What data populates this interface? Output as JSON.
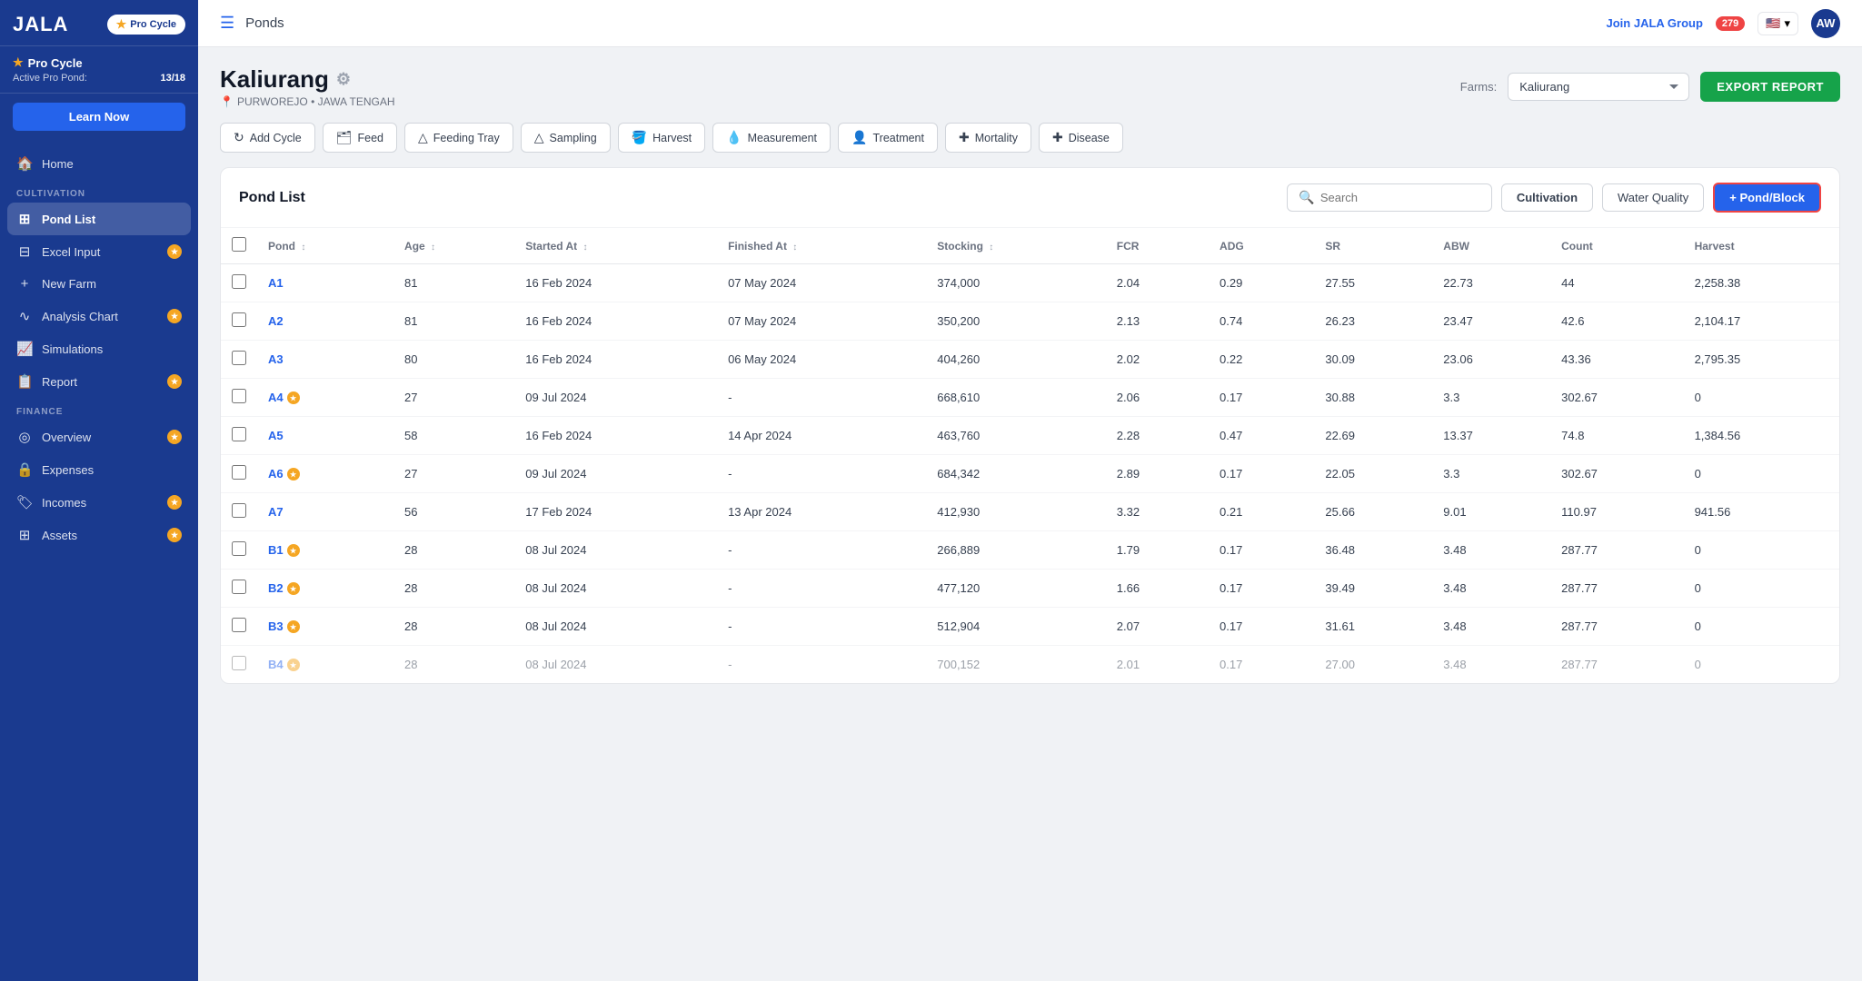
{
  "app": {
    "logo": "JALA",
    "plan_badge": "Pro Cycle",
    "plan_star": "★"
  },
  "sidebar": {
    "pro_title": "Pro Cycle",
    "active_pond_label": "Active Pro Pond:",
    "active_pond_value": "13/18",
    "learn_now": "Learn Now",
    "nav_sections": [
      {
        "label": "",
        "items": [
          {
            "id": "home",
            "icon": "🏠",
            "label": "Home",
            "active": false,
            "badge": false
          }
        ]
      },
      {
        "label": "CULTIVATION",
        "items": [
          {
            "id": "pond-list",
            "icon": "⊞",
            "label": "Pond List",
            "active": true,
            "badge": false
          },
          {
            "id": "excel-input",
            "icon": "⊟",
            "label": "Excel Input",
            "active": false,
            "badge": true
          },
          {
            "id": "new-farm",
            "icon": "+",
            "label": "New Farm",
            "active": false,
            "badge": false
          },
          {
            "id": "analysis-chart",
            "icon": "∿",
            "label": "Analysis Chart",
            "active": false,
            "badge": true
          },
          {
            "id": "simulations",
            "icon": "📈",
            "label": "Simulations",
            "active": false,
            "badge": false
          },
          {
            "id": "report",
            "icon": "📋",
            "label": "Report",
            "active": false,
            "badge": true
          }
        ]
      },
      {
        "label": "FINANCE",
        "items": [
          {
            "id": "overview",
            "icon": "◎",
            "label": "Overview",
            "active": false,
            "badge": true
          },
          {
            "id": "expenses",
            "icon": "🔒",
            "label": "Expenses",
            "active": false,
            "badge": false
          },
          {
            "id": "incomes",
            "icon": "🏷",
            "label": "Incomes",
            "active": false,
            "badge": true
          },
          {
            "id": "assets",
            "icon": "⊞",
            "label": "Assets",
            "active": false,
            "badge": true
          }
        ]
      }
    ]
  },
  "topbar": {
    "title": "Ponds",
    "join_jala": "Join JALA Group",
    "notification_count": "279",
    "flag": "🇺🇸",
    "avatar_initials": "AW"
  },
  "page": {
    "title": "Kaliurang",
    "location": "PURWOREJO • JAWA TENGAH",
    "farms_label": "Farms:",
    "farms_value": "Kaliurang",
    "export_btn": "EXPORT REPORT"
  },
  "action_buttons": [
    {
      "id": "add-cycle",
      "icon": "↻",
      "label": "Add Cycle"
    },
    {
      "id": "feed",
      "icon": "🗂",
      "label": "Feed"
    },
    {
      "id": "feeding-tray",
      "icon": "△",
      "label": "Feeding Tray"
    },
    {
      "id": "sampling",
      "icon": "△",
      "label": "Sampling"
    },
    {
      "id": "harvest",
      "icon": "🪣",
      "label": "Harvest"
    },
    {
      "id": "measurement",
      "icon": "💧",
      "label": "Measurement"
    },
    {
      "id": "treatment",
      "icon": "👤",
      "label": "Treatment"
    },
    {
      "id": "mortality",
      "icon": "✚",
      "label": "Mortality"
    },
    {
      "id": "disease",
      "icon": "✚",
      "label": "Disease"
    }
  ],
  "pond_list": {
    "title": "Pond List",
    "search_placeholder": "Search",
    "tab_cultivation": "Cultivation",
    "tab_water_quality": "Water Quality",
    "tab_pond_block": "+ Pond/Block",
    "columns": [
      {
        "id": "pond",
        "label": "Pond"
      },
      {
        "id": "age",
        "label": "Age",
        "sortable": true
      },
      {
        "id": "started_at",
        "label": "Started At",
        "sortable": true
      },
      {
        "id": "finished_at",
        "label": "Finished At",
        "sortable": true
      },
      {
        "id": "stocking",
        "label": "Stocking",
        "sortable": true
      },
      {
        "id": "fcr",
        "label": "FCR"
      },
      {
        "id": "adg",
        "label": "ADG"
      },
      {
        "id": "sr",
        "label": "SR"
      },
      {
        "id": "abw",
        "label": "ABW"
      },
      {
        "id": "count",
        "label": "Count"
      },
      {
        "id": "harvest",
        "label": "Harvest"
      }
    ],
    "rows": [
      {
        "pond": "A1",
        "pro": false,
        "age": "81",
        "started_at": "16 Feb 2024",
        "finished_at": "07 May 2024",
        "stocking": "374,000",
        "fcr": "2.04",
        "adg": "0.29",
        "sr": "27.55",
        "abw": "22.73",
        "count": "44",
        "harvest": "2,258.38"
      },
      {
        "pond": "A2",
        "pro": false,
        "age": "81",
        "started_at": "16 Feb 2024",
        "finished_at": "07 May 2024",
        "stocking": "350,200",
        "fcr": "2.13",
        "adg": "0.74",
        "sr": "26.23",
        "abw": "23.47",
        "count": "42.6",
        "harvest": "2,104.17"
      },
      {
        "pond": "A3",
        "pro": false,
        "age": "80",
        "started_at": "16 Feb 2024",
        "finished_at": "06 May 2024",
        "stocking": "404,260",
        "fcr": "2.02",
        "adg": "0.22",
        "sr": "30.09",
        "abw": "23.06",
        "count": "43.36",
        "harvest": "2,795.35"
      },
      {
        "pond": "A4",
        "pro": true,
        "age": "27",
        "started_at": "09 Jul 2024",
        "finished_at": "-",
        "stocking": "668,610",
        "fcr": "2.06",
        "adg": "0.17",
        "sr": "30.88",
        "abw": "3.3",
        "count": "302.67",
        "harvest": "0"
      },
      {
        "pond": "A5",
        "pro": false,
        "age": "58",
        "started_at": "16 Feb 2024",
        "finished_at": "14 Apr 2024",
        "stocking": "463,760",
        "fcr": "2.28",
        "adg": "0.47",
        "sr": "22.69",
        "abw": "13.37",
        "count": "74.8",
        "harvest": "1,384.56"
      },
      {
        "pond": "A6",
        "pro": true,
        "age": "27",
        "started_at": "09 Jul 2024",
        "finished_at": "-",
        "stocking": "684,342",
        "fcr": "2.89",
        "adg": "0.17",
        "sr": "22.05",
        "abw": "3.3",
        "count": "302.67",
        "harvest": "0"
      },
      {
        "pond": "A7",
        "pro": false,
        "age": "56",
        "started_at": "17 Feb 2024",
        "finished_at": "13 Apr 2024",
        "stocking": "412,930",
        "fcr": "3.32",
        "adg": "0.21",
        "sr": "25.66",
        "abw": "9.01",
        "count": "110.97",
        "harvest": "941.56"
      },
      {
        "pond": "B1",
        "pro": true,
        "age": "28",
        "started_at": "08 Jul 2024",
        "finished_at": "-",
        "stocking": "266,889",
        "fcr": "1.79",
        "adg": "0.17",
        "sr": "36.48",
        "abw": "3.48",
        "count": "287.77",
        "harvest": "0"
      },
      {
        "pond": "B2",
        "pro": true,
        "age": "28",
        "started_at": "08 Jul 2024",
        "finished_at": "-",
        "stocking": "477,120",
        "fcr": "1.66",
        "adg": "0.17",
        "sr": "39.49",
        "abw": "3.48",
        "count": "287.77",
        "harvest": "0"
      },
      {
        "pond": "B3",
        "pro": true,
        "age": "28",
        "started_at": "08 Jul 2024",
        "finished_at": "-",
        "stocking": "512,904",
        "fcr": "2.07",
        "adg": "0.17",
        "sr": "31.61",
        "abw": "3.48",
        "count": "287.77",
        "harvest": "0"
      },
      {
        "pond": "B4",
        "pro": true,
        "age": "28",
        "started_at": "08 Jul 2024",
        "finished_at": "-",
        "stocking": "700,152",
        "fcr": "2.01",
        "adg": "0.17",
        "sr": "27.00",
        "abw": "3.48",
        "count": "287.77",
        "harvest": "0"
      }
    ]
  }
}
